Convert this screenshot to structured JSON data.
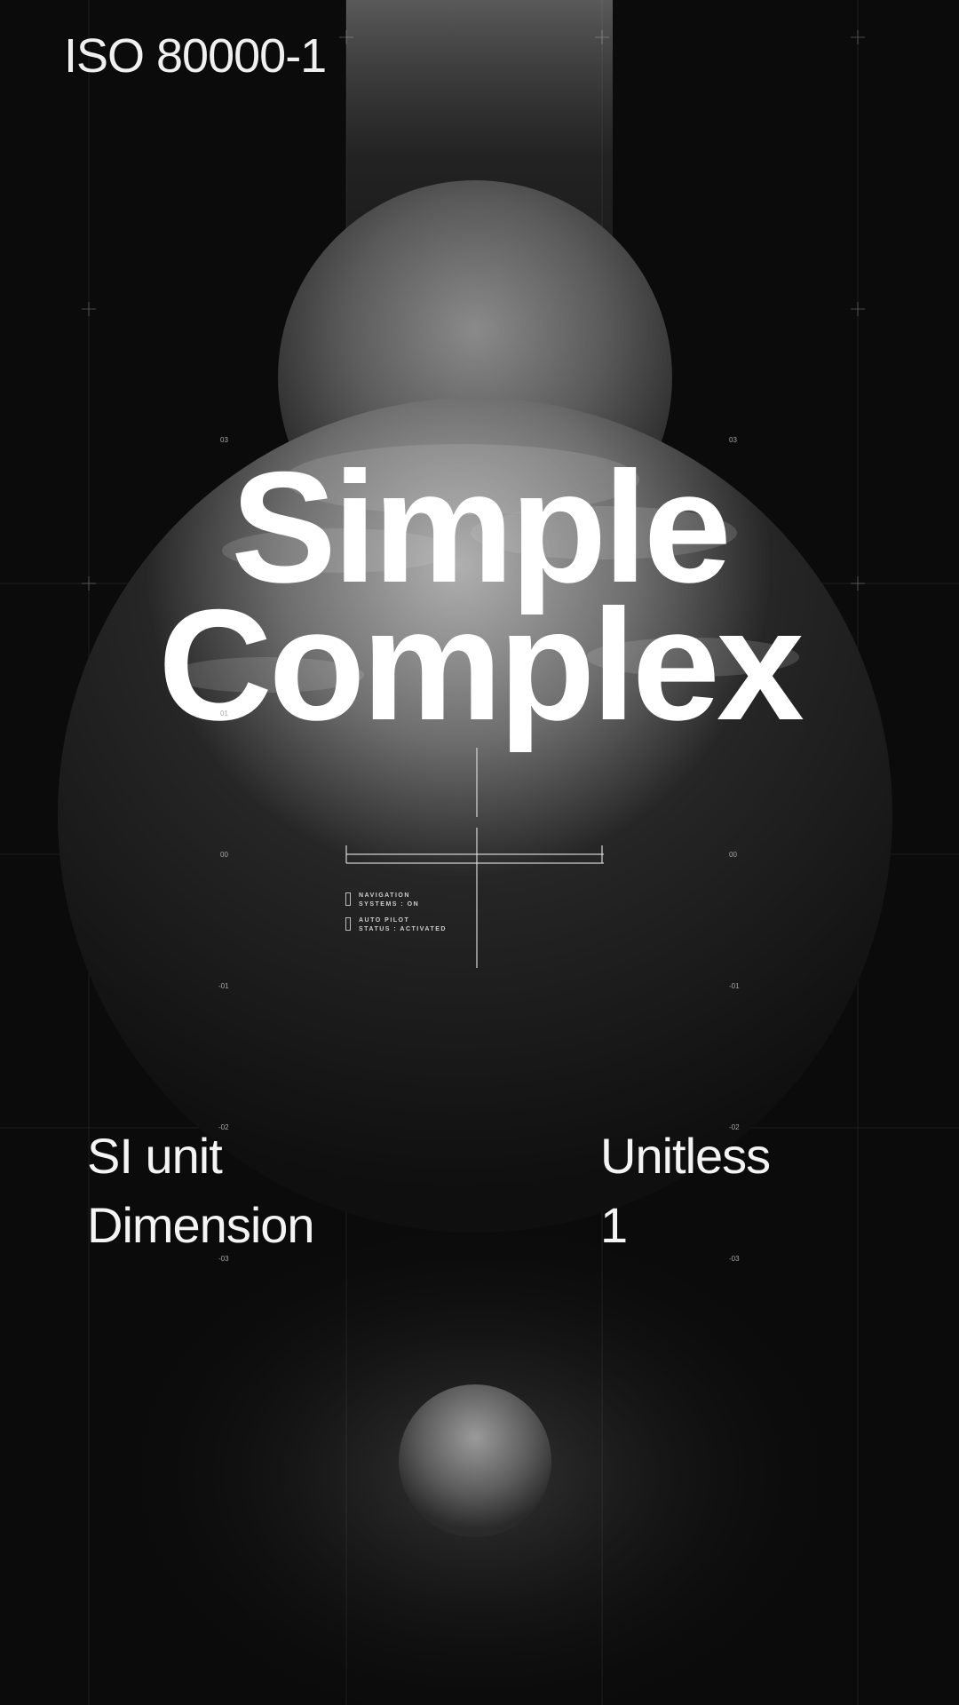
{
  "header": {
    "title": "ISO 80000-1"
  },
  "headline": {
    "line1": "Simple",
    "line2": "Complex"
  },
  "hud": {
    "status1": "NAVIGATION\nSYSTEMS : ON",
    "status2": "AUTO PILOT\nSTATUS : ACTIVATED"
  },
  "axis_ticks": [
    "03",
    "01",
    "00",
    "-01",
    "-02",
    "-03"
  ],
  "specs": {
    "si_unit_label": "SI unit",
    "si_unit_value": "Unitless",
    "dimension_label": "Dimension",
    "dimension_value": "1"
  }
}
